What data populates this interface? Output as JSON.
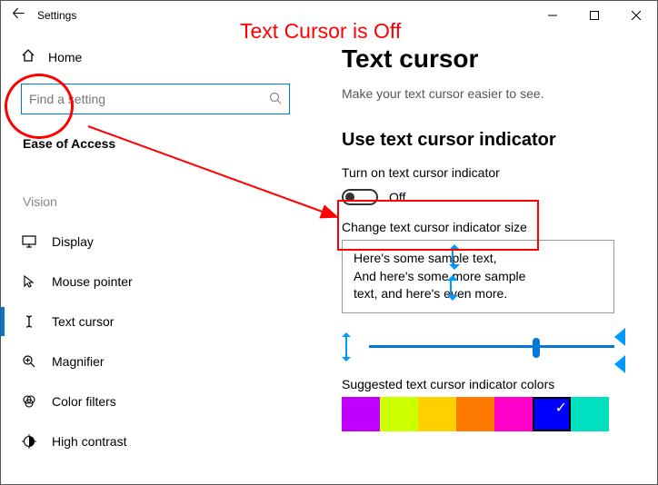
{
  "window": {
    "title": "Settings"
  },
  "annotation": {
    "title": "Text Cursor is Off"
  },
  "sidebar": {
    "home": "Home",
    "search_placeholder": "Find a setting",
    "section": "Ease of Access",
    "category": "Vision",
    "items": [
      {
        "icon": "display",
        "label": "Display"
      },
      {
        "icon": "mouse",
        "label": "Mouse pointer"
      },
      {
        "icon": "textcursor",
        "label": "Text cursor"
      },
      {
        "icon": "magnifier",
        "label": "Magnifier"
      },
      {
        "icon": "colorfilters",
        "label": "Color filters"
      },
      {
        "icon": "contrast",
        "label": "High contrast"
      }
    ]
  },
  "content": {
    "title": "Text cursor",
    "subtitle": "Make your text cursor easier to see.",
    "section_heading": "Use text cursor indicator",
    "toggle_label": "Turn on text cursor indicator",
    "toggle_state": "Off",
    "size_label": "Change text cursor indicator size",
    "sample_line1": "Here's some sample text,",
    "sample_line2": "And here's some more sample",
    "sample_line3": "text, and here's even more.",
    "colors_label": "Suggested text cursor indicator colors",
    "swatches": [
      "#c000ff",
      "#ccff00",
      "#ffd000",
      "#ff7a00",
      "#ff00c8",
      "#0000ff",
      "#00e0c0"
    ],
    "selected_swatch": 5
  }
}
